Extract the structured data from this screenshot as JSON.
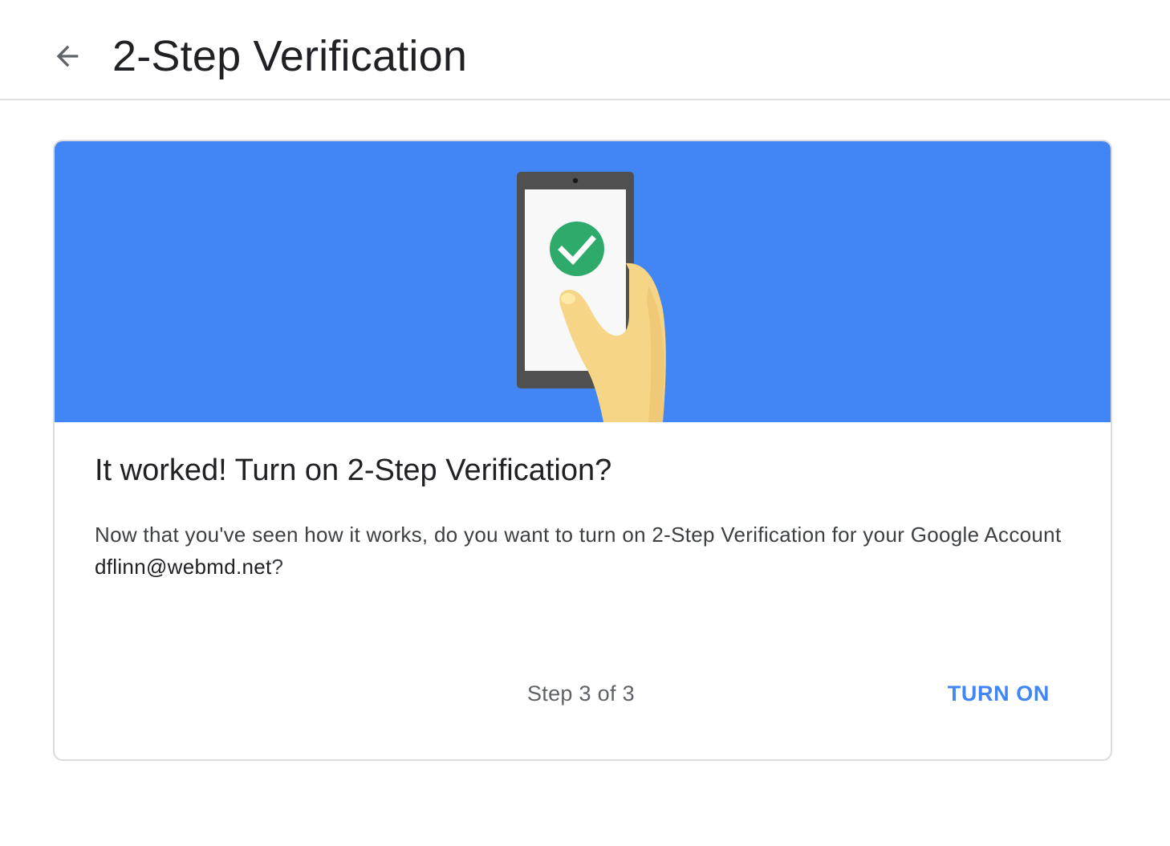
{
  "header": {
    "back_icon": "arrow-back-icon",
    "title": "2-Step Verification"
  },
  "card": {
    "hero": {
      "background_color": "#4285f4",
      "illustration": "phone-in-hand-with-checkmark",
      "check_color": "#2eab6b",
      "hand_color": "#f6d586"
    },
    "heading": "It worked! Turn on 2-Step Verification?",
    "body_text": "Now that you've seen how it works, do you want to turn on 2-Step Verification for your Google Account ",
    "email": "dflinn@webmd.net",
    "body_suffix": "?",
    "footer": {
      "step_text": "Step 3 of 3",
      "turn_on_label": "TURN ON",
      "accent_color": "#4285f4"
    }
  }
}
